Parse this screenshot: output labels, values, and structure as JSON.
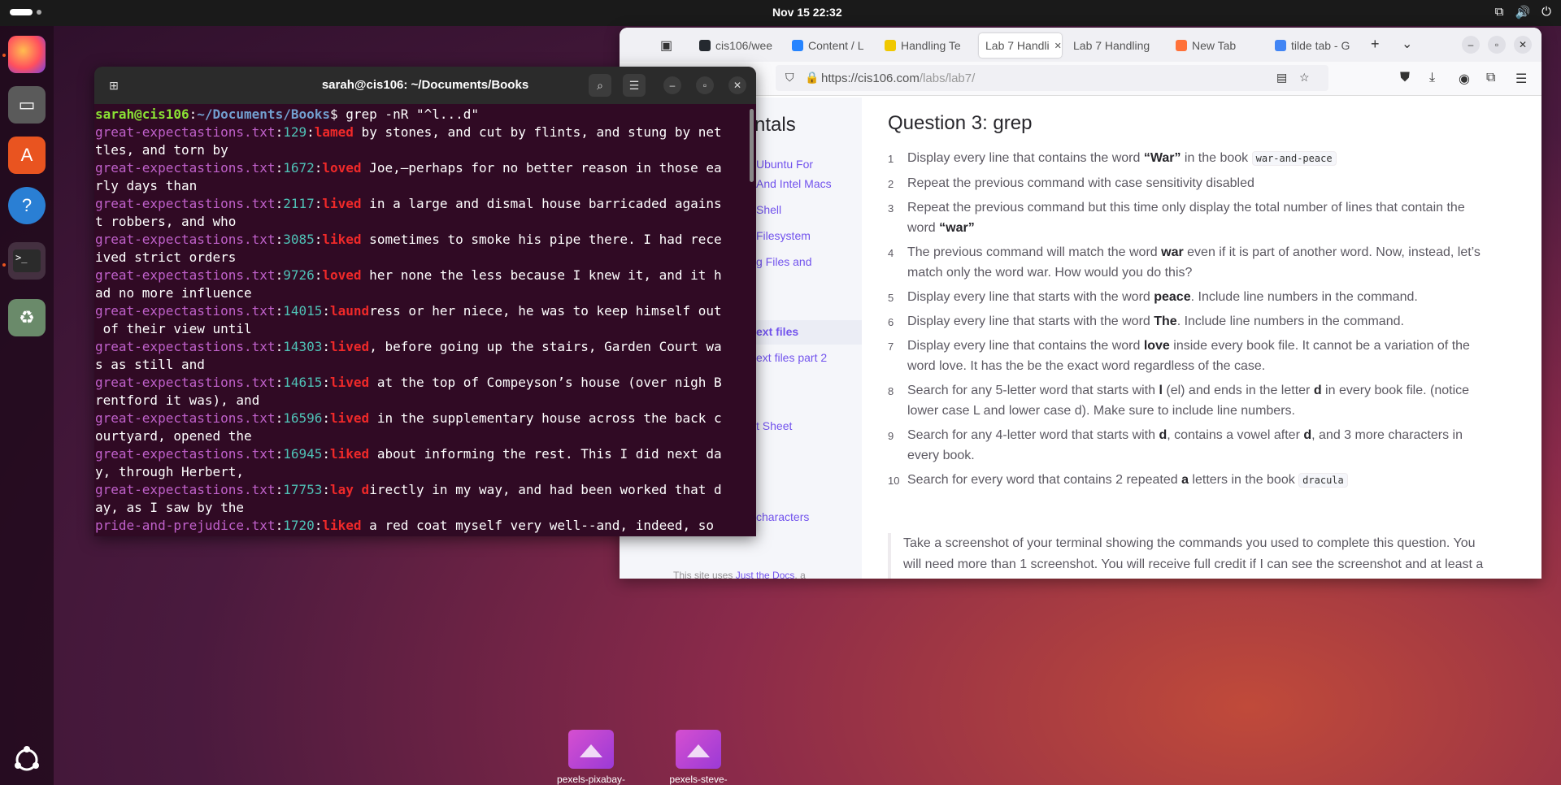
{
  "topbar": {
    "clock": "Nov 15  22:32"
  },
  "terminal": {
    "title": "sarah@cis106: ~/Documents/Books",
    "prompt_user": "sarah@cis106",
    "prompt_path": "~/Documents/Books",
    "command": "$ grep -nR \"^l...d\"",
    "lines": [
      {
        "file": "great-expectastions.txt",
        "num": "129",
        "match": "lamed",
        "rest": " by stones, and cut by flints, and stung by net",
        "cont": "tles, and torn by"
      },
      {
        "file": "great-expectastions.txt",
        "num": "1672",
        "match": "loved",
        "rest": " Joe,—perhaps for no better reason in those ea",
        "cont": "rly days than"
      },
      {
        "file": "great-expectastions.txt",
        "num": "2117",
        "match": "lived",
        "rest": " in a large and dismal house barricaded agains",
        "cont": "t robbers, and who"
      },
      {
        "file": "great-expectastions.txt",
        "num": "3085",
        "match": "liked",
        "rest": " sometimes to smoke his pipe there. I had rece",
        "cont": "ived strict orders"
      },
      {
        "file": "great-expectastions.txt",
        "num": "9726",
        "match": "loved",
        "rest": " her none the less because I knew it, and it h",
        "cont": "ad no more influence"
      },
      {
        "file": "great-expectastions.txt",
        "num": "14015",
        "match": "laund",
        "rest": "ress or her niece, he was to keep himself out",
        "cont": " of their view until"
      },
      {
        "file": "great-expectastions.txt",
        "num": "14303",
        "match": "lived",
        "rest": ", before going up the stairs, Garden Court wa",
        "cont": "s as still and"
      },
      {
        "file": "great-expectastions.txt",
        "num": "14615",
        "match": "lived",
        "rest": " at the top of Compeyson’s house (over nigh B",
        "cont": "rentford it was), and"
      },
      {
        "file": "great-expectastions.txt",
        "num": "16596",
        "match": "lived",
        "rest": " in the supplementary house across the back c",
        "cont": "ourtyard, opened the"
      },
      {
        "file": "great-expectastions.txt",
        "num": "16945",
        "match": "liked",
        "rest": " about informing the rest. This I did next da",
        "cont": "y, through Herbert,"
      },
      {
        "file": "great-expectastions.txt",
        "num": "17753",
        "match": "lay d",
        "rest": "irectly in my way, and had been worked that d",
        "cont": "ay, as I saw by the"
      },
      {
        "file": "pride-and-prejudice.txt",
        "num": "1720",
        "match": "liked",
        "rest": " a red coat myself very well--and, indeed, so",
        "cont": ""
      }
    ]
  },
  "browser": {
    "tabs": [
      {
        "label": "cis106/wee",
        "color": "#24292f"
      },
      {
        "label": "Content / L",
        "color": "#2684ff"
      },
      {
        "label": "Handling Te",
        "color": "#f0c800"
      },
      {
        "label": "Lab 7 Handli",
        "color": ""
      },
      {
        "label": "Lab 7 Handling",
        "color": ""
      },
      {
        "label": "New Tab",
        "color": "#ff7139"
      },
      {
        "label": "tilde tab - G",
        "color": "#4285f4"
      }
    ],
    "url_host": "https://cis106.com",
    "url_path": "/labs/lab7/",
    "sidebar": {
      "heading": "ntals",
      "items": [
        "Ubuntu For",
        "And Intel Macs",
        "Shell",
        "Filesystem",
        "g Files and",
        "ext files",
        "ext files part 2",
        "t Sheet",
        "characters"
      ],
      "footer_pre": "This site uses ",
      "footer_link": "Just the Docs",
      "footer_post": ", a documentation theme for Jekyll."
    },
    "content": {
      "title": "Question 3: grep",
      "questions": [
        {
          "n": "1",
          "a": "Display every line that contains the word ",
          "b": "“War”",
          "c": " in the book ",
          "code": "war-and-peace",
          "d": ""
        },
        {
          "n": "2",
          "a": "Repeat the previous command with case sensitivity disabled",
          "b": "",
          "c": "",
          "code": "",
          "d": ""
        },
        {
          "n": "3",
          "a": "Repeat the previous command but this time only display the total number of lines that contain the word ",
          "b": "“war”",
          "c": "",
          "code": "",
          "d": ""
        },
        {
          "n": "4",
          "a": "The previous command will match the word ",
          "b": "war",
          "c": " even if it is part of another word. Now, instead, let’s match only the word war. How would you do this?",
          "code": "",
          "d": ""
        },
        {
          "n": "5",
          "a": "Display every line that starts with the word ",
          "b": "peace",
          "c": ". Include line numbers in the command.",
          "code": "",
          "d": ""
        },
        {
          "n": "6",
          "a": "Display every line that starts with the word ",
          "b": "The",
          "c": ". Include line numbers in the command.",
          "code": "",
          "d": ""
        },
        {
          "n": "7",
          "a": "Display every line that contains the word ",
          "b": "love",
          "c": " inside every book file. It cannot be a variation of the word love. It has the be the exact word regardless of the case.",
          "code": "",
          "d": ""
        },
        {
          "n": "8",
          "a": "Search for any 5-letter word that starts with ",
          "b": "l",
          "c": " (el) and ends in the letter ",
          "code": "",
          "d": "",
          "b2": "d",
          "c2": " in every book file. (notice lower case L and lower case d). Make sure to include line numbers."
        },
        {
          "n": "9",
          "a": "Search for any 4-letter word that starts with ",
          "b": "d",
          "c": ", contains a vowel after ",
          "code": "",
          "d": "",
          "b2": "d",
          "c2": ", and 3 more characters in every book."
        },
        {
          "n": "10",
          "a": "Search for every word that contains 2 repeated ",
          "b": "a",
          "c": " letters in the book ",
          "code": "dracula",
          "d": ""
        }
      ],
      "note": "Take a screenshot of your terminal showing the commands you used to complete this question. You will need more than 1 screenshot. You will receive full credit if I can see the screenshot and at least a portion of the output."
    }
  },
  "desktop": {
    "icons": [
      "pexels-pixabay-",
      "pexels-steve-"
    ]
  }
}
